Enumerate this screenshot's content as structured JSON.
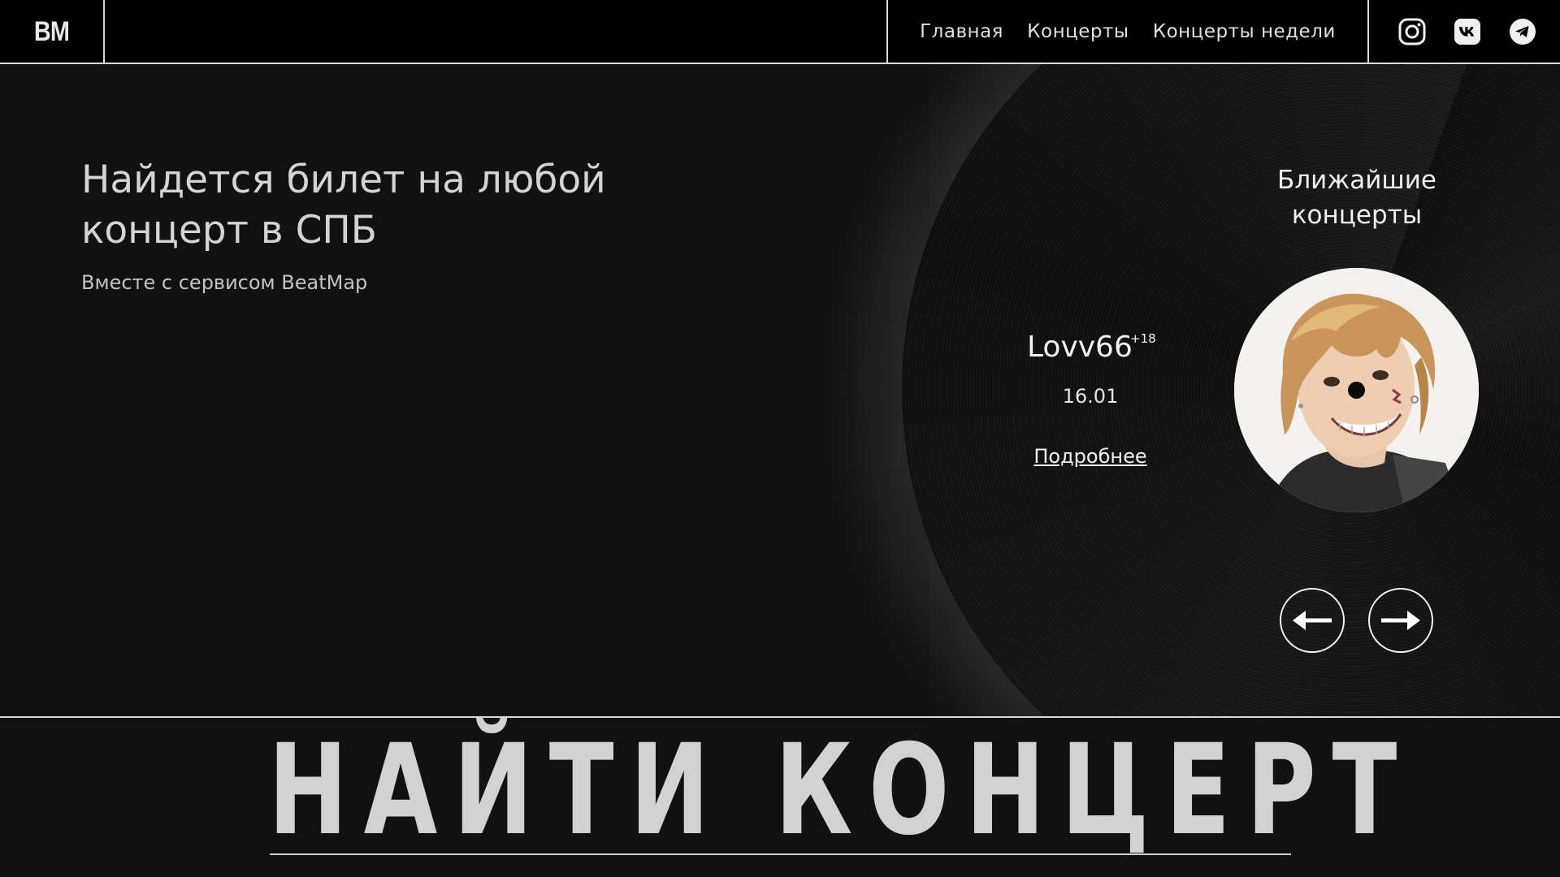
{
  "header": {
    "logo": "BM",
    "nav": [
      {
        "label": "Главная"
      },
      {
        "label": "Концерты"
      },
      {
        "label": "Концерты недели"
      }
    ],
    "social_icons": [
      "instagram-icon",
      "vk-icon",
      "telegram-icon"
    ]
  },
  "hero": {
    "headline": "Найдется билет на любой концерт в СПБ",
    "subline": "Вместе с сервисом BeatMap"
  },
  "upcoming": {
    "title": "Ближайшие концерты",
    "artist": "Lovv66",
    "age_rating": "+18",
    "date": "16.01",
    "more_label": "Подробнее"
  },
  "cta": {
    "label": "НАЙТИ КОНЦЕРТ"
  },
  "colors": {
    "background": "#111111",
    "header_bg": "#000000",
    "text": "#d4d4d4",
    "border": "#d9d9d9"
  }
}
